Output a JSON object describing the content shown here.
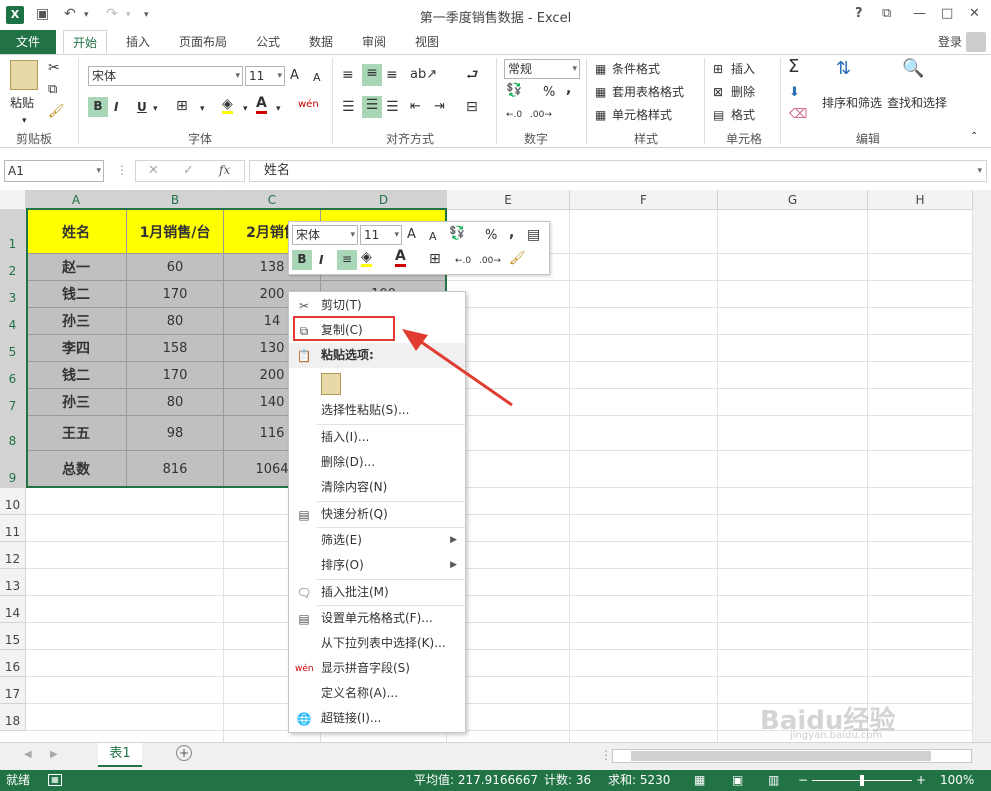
{
  "window": {
    "title": "第一季度销售数据 - Excel",
    "help": "?",
    "ribbon_opts": "⧉",
    "minimize": "—",
    "maximize": "□",
    "close": "✕"
  },
  "qat": {
    "save": "💾",
    "undo": "↶",
    "redo": "↷",
    "customize": "▾"
  },
  "tabs": {
    "file": "文件",
    "home": "开始",
    "insert": "插入",
    "page_layout": "页面布局",
    "formulas": "公式",
    "data": "数据",
    "review": "审阅",
    "view": "视图",
    "signin": "登录"
  },
  "ribbon": {
    "clipboard": {
      "paste": "粘贴",
      "label": "剪贴板"
    },
    "font": {
      "name": "宋体",
      "size": "11",
      "grow": "A",
      "shrink": "A",
      "bold": "B",
      "italic": "I",
      "underline": "U",
      "label": "字体",
      "phonetic": "wén"
    },
    "alignment": {
      "label": "对齐方式"
    },
    "number": {
      "format": "常规",
      "percent": "%",
      "comma": ",",
      "label": "数字"
    },
    "styles": {
      "conditional": "条件格式",
      "table": "套用表格格式",
      "cell_styles": "单元格样式",
      "label": "样式"
    },
    "cells": {
      "insert": "插入",
      "delete": "删除",
      "format": "格式",
      "label": "单元格"
    },
    "editing": {
      "sigma": "Σ",
      "sort_filter": "排序和筛选",
      "find_select": "查找和选择",
      "label": "编辑"
    }
  },
  "formula_bar": {
    "name_box": "A1",
    "fx": "fx",
    "content": "姓名"
  },
  "columns": [
    "A",
    "B",
    "C",
    "D",
    "E",
    "F",
    "G",
    "H"
  ],
  "rows": [
    "1",
    "2",
    "3",
    "4",
    "5",
    "6",
    "7",
    "8",
    "9",
    "10",
    "11",
    "12",
    "13",
    "14",
    "15",
    "16",
    "17",
    "18"
  ],
  "table": {
    "header": [
      "姓名",
      "1月销售/台",
      "2月销售",
      ""
    ],
    "rows": [
      [
        "赵一",
        "60",
        "138"
      ],
      [
        "钱二",
        "170",
        "200",
        "100"
      ],
      [
        "孙三",
        "80",
        "14"
      ],
      [
        "李四",
        "158",
        "130"
      ],
      [
        "钱二",
        "170",
        "200"
      ],
      [
        "孙三",
        "80",
        "140"
      ],
      [
        "王五",
        "98",
        "116"
      ],
      [
        "总数",
        "816",
        "1064"
      ]
    ]
  },
  "mini_toolbar": {
    "font": "宋体",
    "size": "11",
    "bold": "B",
    "italic": "I",
    "percent": "%",
    "comma": ","
  },
  "context_menu": {
    "cut": "剪切(T)",
    "copy": "复制(C)",
    "paste_options": "粘贴选项:",
    "paste_special": "选择性粘贴(S)...",
    "insert": "插入(I)...",
    "delete": "删除(D)...",
    "clear": "清除内容(N)",
    "quick_analysis": "快速分析(Q)",
    "filter": "筛选(E)",
    "sort": "排序(O)",
    "insert_comment": "插入批注(M)",
    "format_cells": "设置单元格格式(F)...",
    "pick_list": "从下拉列表中选择(K)...",
    "phonetic": "显示拼音字段(S)",
    "define_name": "定义名称(A)...",
    "hyperlink": "超链接(I)..."
  },
  "sheet": {
    "tab": "表1",
    "add": "+"
  },
  "status": {
    "ready": "就绪",
    "average": "平均值: 217.9166667",
    "count": "计数: 36",
    "sum": "求和: 5230",
    "zoom": "100%"
  },
  "watermark": {
    "text": "Baidu经验",
    "sub": "jingyan.baidu.com"
  },
  "colors": {
    "excel_green": "#217346",
    "header_yellow": "#ffff00",
    "data_gray": "#c0c0c0",
    "highlight_red": "#e03c31"
  }
}
